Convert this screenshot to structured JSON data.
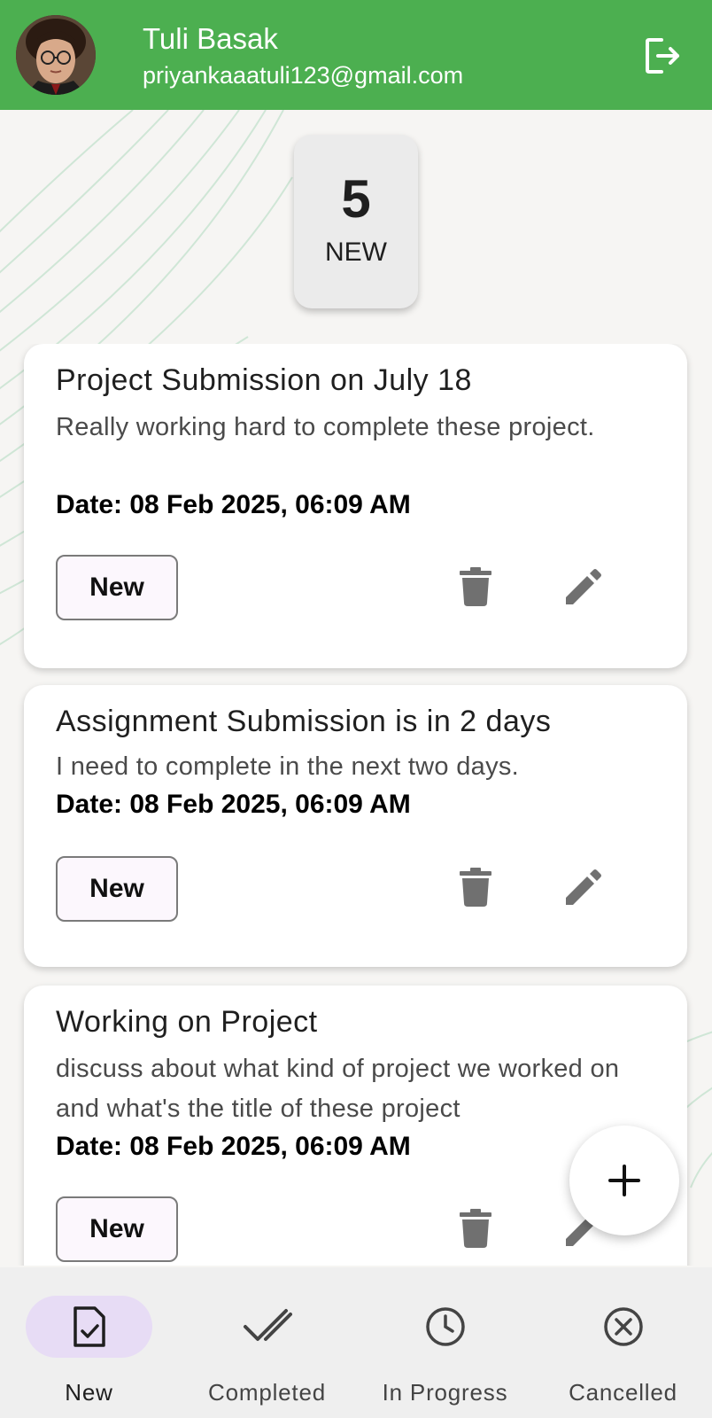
{
  "header": {
    "name": "Tuli Basak",
    "email": "priyankaaatuli123@gmail.com",
    "bg_color": "#4caf50"
  },
  "summary": {
    "count": "5",
    "label": "NEW"
  },
  "tasks": [
    {
      "title": "Project Submission on July 18",
      "description": "Really working hard to complete these project.",
      "date": "Date: 08 Feb 2025, 06:09 AM",
      "status": "New"
    },
    {
      "title": "Assignment Submission is in 2 days",
      "description": "I need to complete in the next two days.",
      "date": "Date: 08 Feb 2025, 06:09 AM",
      "status": "New"
    },
    {
      "title": "Working on Project",
      "description": "discuss about what kind of project we worked on and what's the title of these project",
      "date": "Date: 08 Feb 2025, 06:09 AM",
      "status": "New"
    }
  ],
  "icons": {
    "logout": "logout-icon",
    "delete": "trash-icon",
    "edit": "pencil-icon",
    "add": "plus-icon"
  },
  "nav": {
    "items": [
      {
        "label": "New",
        "icon": "task-check-icon",
        "active": true
      },
      {
        "label": "Completed",
        "icon": "double-check-icon",
        "active": false
      },
      {
        "label": "In Progress",
        "icon": "clock-icon",
        "active": false
      },
      {
        "label": "Cancelled",
        "icon": "cancel-circle-icon",
        "active": false
      }
    ],
    "active_pill_color": "#e7dcf5"
  }
}
